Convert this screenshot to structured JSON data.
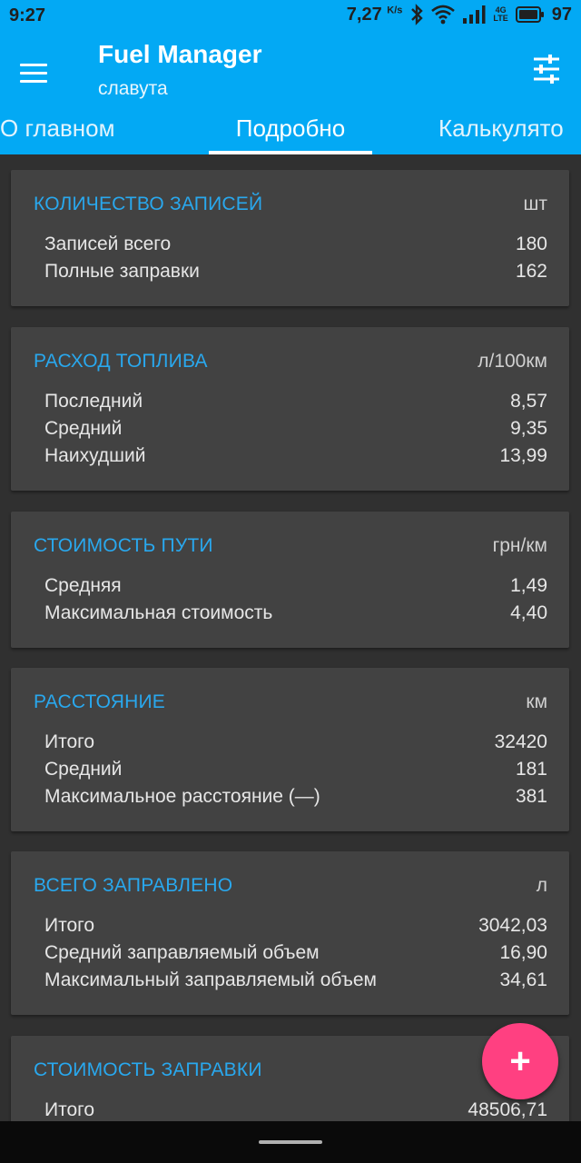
{
  "status": {
    "time": "9:27",
    "speed": "7,27",
    "speed_unit": "K/s",
    "battery": "97"
  },
  "header": {
    "title": "Fuel Manager",
    "subtitle": "славута"
  },
  "tabs": [
    {
      "label": "О главном"
    },
    {
      "label": "Подробно"
    },
    {
      "label": "Калькулято"
    }
  ],
  "cards": [
    {
      "title": "КОЛИЧЕСТВО ЗАПИСЕЙ",
      "unit": "шт",
      "rows": [
        {
          "label": "Записей всего",
          "value": "180"
        },
        {
          "label": "Полные заправки",
          "value": "162"
        }
      ]
    },
    {
      "title": "РАСХОД ТОПЛИВА",
      "unit": "л/100км",
      "rows": [
        {
          "label": "Последний",
          "value": "8,57"
        },
        {
          "label": "Средний",
          "value": "9,35"
        },
        {
          "label": "Наихудший",
          "value": "13,99"
        }
      ]
    },
    {
      "title": "СТОИМОСТЬ ПУТИ",
      "unit": "грн/км",
      "rows": [
        {
          "label": "Средняя",
          "value": "1,49"
        },
        {
          "label": "Максимальная стоимость",
          "value": "4,40"
        }
      ]
    },
    {
      "title": "РАССТОЯНИЕ",
      "unit": "км",
      "rows": [
        {
          "label": "Итого",
          "value": "32420"
        },
        {
          "label": "Средний",
          "value": "181"
        },
        {
          "label": "Максимальное расстояние (—)",
          "value": "381"
        }
      ]
    },
    {
      "title": "ВСЕГО ЗАПРАВЛЕНО",
      "unit": "л",
      "rows": [
        {
          "label": "Итого",
          "value": "3042,03"
        },
        {
          "label": "Средний заправляемый объем",
          "value": "16,90"
        },
        {
          "label": "Максимальный заправляемый объем",
          "value": "34,61"
        }
      ]
    },
    {
      "title": "СТОИМОСТЬ ЗАПРАВКИ",
      "unit": "",
      "rows": [
        {
          "label": "Итого",
          "value": "48506,71"
        }
      ]
    }
  ],
  "fab": {
    "label": "+"
  },
  "colors": {
    "primary": "#03A9F4",
    "accent": "#FF4081",
    "card_title": "#29a8ee",
    "background": "#303030",
    "card": "#424242"
  }
}
